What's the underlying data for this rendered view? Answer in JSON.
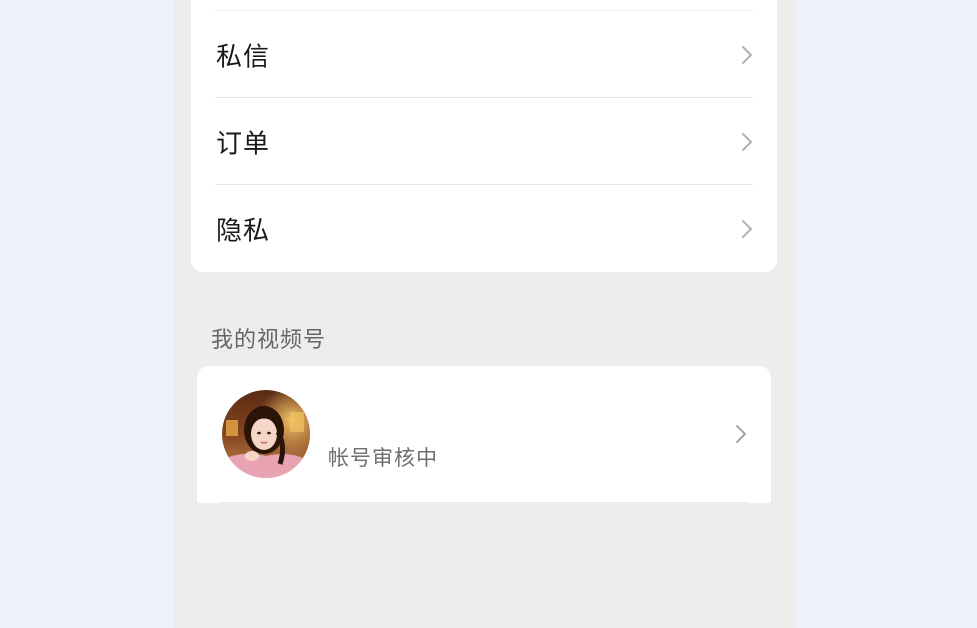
{
  "menu": {
    "items": [
      {
        "label": "私信",
        "icon": "chevron-right-icon"
      },
      {
        "label": "订单",
        "icon": "chevron-right-icon"
      },
      {
        "label": "隐私",
        "icon": "chevron-right-icon"
      }
    ]
  },
  "channels": {
    "section_title": "我的视频号",
    "account": {
      "status": "帐号审核中",
      "avatar": "user-avatar-photo",
      "icon": "chevron-right-icon"
    }
  },
  "colors": {
    "page_background": "#eef2fa",
    "screen_background": "#ededed",
    "card_background": "#ffffff",
    "chevron": "#b2b2b2"
  }
}
